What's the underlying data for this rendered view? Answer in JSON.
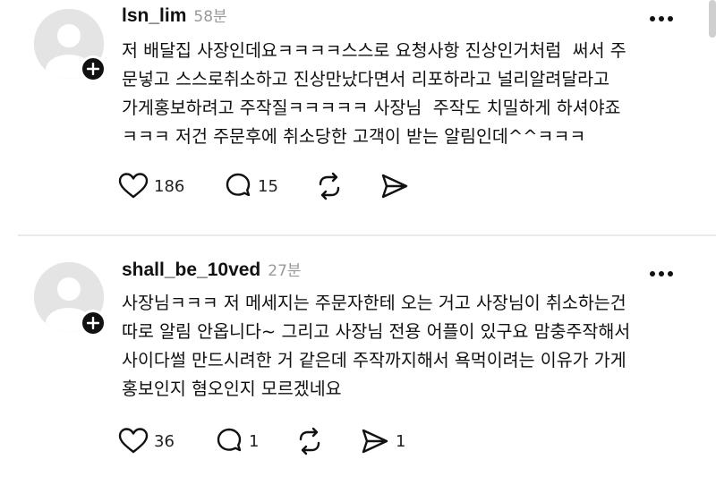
{
  "posts": [
    {
      "username": "lsn_lim",
      "time": "58분",
      "text": "저 배달집 사장인데요ㅋㅋㅋㅋ스스로 요청사항 진상인거처럼  써서 주\n문넣고 스스로취소하고 진상만났다면서 리포하라고 널리알려달라고\n가게홍보하려고 주작질ㅋㅋㅋㅋㅋ 사장님  주작도 치밀하게 하셔야죠\nㅋㅋㅋ 저건 주문후에 취소당한 고객이 받는 알림인데^^ㅋㅋㅋ",
      "likes": "186",
      "replies": "15",
      "reposts": "",
      "shares": ""
    },
    {
      "username": "shall_be_10ved",
      "time": "27분",
      "text": "사장님ㅋㅋㅋ 저 메세지는 주문자한테 오는 거고 사장님이 취소하는건\n따로 알림 안옵니다~ 그리고 사장님 전용 어플이 있구요 맘충주작해서\n사이다썰 만드시려한 거 같은데 주작까지해서 욕먹이려는 이유가 가게\n홍보인지 혐오인지 모르겠네요",
      "likes": "36",
      "replies": "1",
      "reposts": "",
      "shares": "1"
    }
  ],
  "icons": {
    "like": "heart-icon",
    "reply": "comment-icon",
    "repost": "repost-icon",
    "share": "send-icon",
    "more": "more-icon",
    "follow": "plus-icon",
    "avatar": "default-avatar-icon"
  }
}
